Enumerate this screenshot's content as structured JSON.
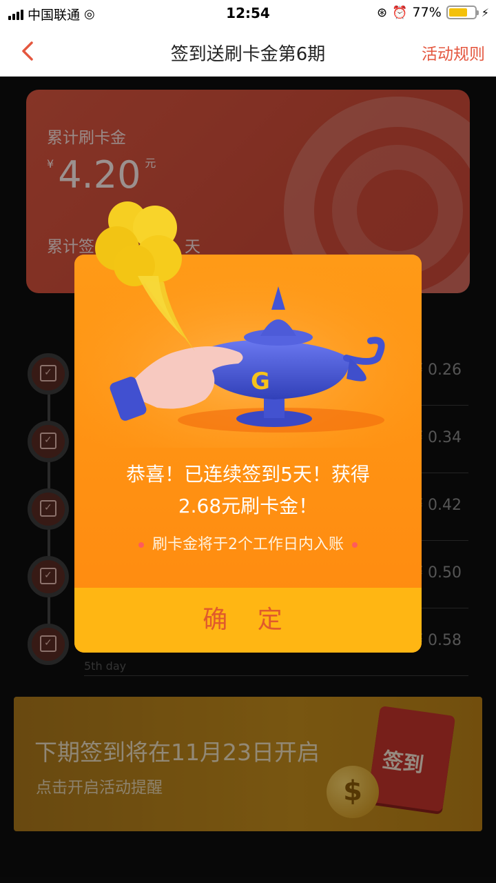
{
  "status_bar": {
    "carrier": "中国联通",
    "time": "12:54",
    "battery_percent": "77%"
  },
  "nav": {
    "back_icon": "chevron-left-icon",
    "title": "签到送刷卡金第6期",
    "rules_link": "活动规则"
  },
  "card": {
    "total_label": "累计刷卡金",
    "currency_symbol": "¥",
    "amount": "4.20",
    "unit": "元",
    "streak_label": "累计签",
    "streak_tail": "天"
  },
  "days": [
    {
      "reward": "¥ 0.26",
      "sub": ""
    },
    {
      "reward": "¥ 0.34",
      "sub": ""
    },
    {
      "reward": "¥ 0.42",
      "sub": ""
    },
    {
      "reward": "¥ 0.50",
      "sub": ""
    },
    {
      "reward": "¥ 0.58",
      "sub": "5th day"
    }
  ],
  "banner": {
    "title": "下期签到将在11月23日开启",
    "subtitle": "点击开启活动提醒",
    "calendar_text": "签到",
    "coin_symbol": "$"
  },
  "modal": {
    "message_line1": "恭喜！已连续签到5天！获得",
    "message_line2": "2.68元刷卡金！",
    "note": "刷卡金将于2个工作日内入账",
    "confirm_label": "确 定",
    "lamp_letter": "G"
  },
  "colors": {
    "accent": "#e4573f",
    "modal_bg": "#ff9012",
    "confirm_bg": "#ffb613",
    "lamp": "#4b5bd6"
  }
}
